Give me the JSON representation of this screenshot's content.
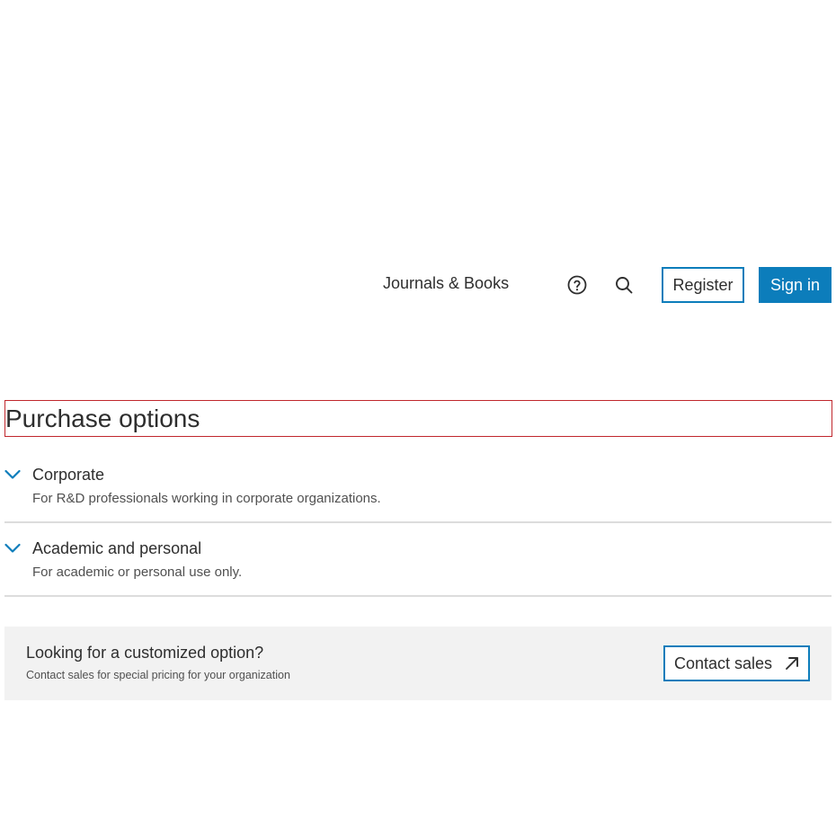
{
  "header": {
    "nav_link": "Journals & Books",
    "help_icon": "help-circle-icon",
    "search_icon": "search-icon",
    "register_label": "Register",
    "signin_label": "Sign in"
  },
  "page": {
    "title": "Purchase options"
  },
  "accordion": {
    "items": [
      {
        "title": "Corporate",
        "description": "For R&D professionals working in corporate organizations.",
        "icon": "chevron-down-icon"
      },
      {
        "title": "Academic and personal",
        "description": "For academic or personal use only.",
        "icon": "chevron-down-icon"
      }
    ]
  },
  "custom_option": {
    "title": "Looking for a customized option?",
    "description": "Contact sales for special pricing for your organization",
    "button_label": "Contact sales",
    "button_icon": "arrow-up-right-icon"
  },
  "colors": {
    "accent": "#0c7dbb",
    "title_border": "#c0272d",
    "panel_bg": "#f2f2f2",
    "divider": "#dcdcdc",
    "text": "#2e2e2e"
  }
}
